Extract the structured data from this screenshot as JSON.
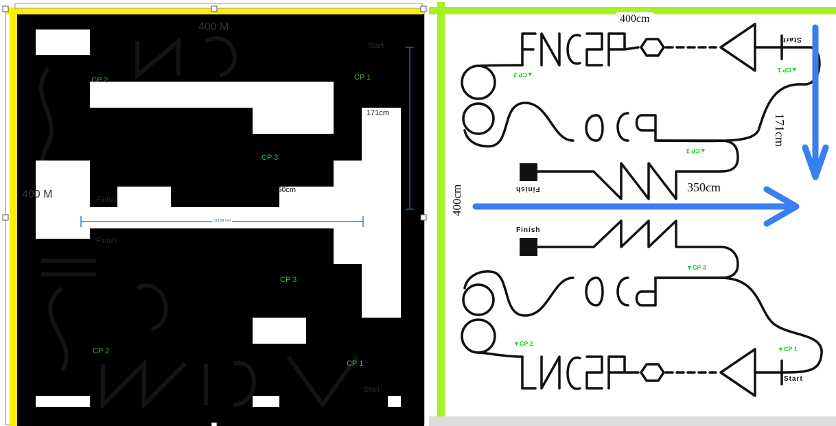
{
  "colors": {
    "yellow_border": "#ffee00",
    "green_border": "#a6f028",
    "track": "#111111",
    "arrow": "#3a7ff0",
    "checkpoint": "#17d017",
    "dimension_line": "#1f6fb0"
  },
  "left": {
    "dimensions": {
      "top_width": "400 M",
      "side_height": "400 M",
      "right_measure": "171cm",
      "middle_measure": "350cm",
      "ruler_label": "310.84 mm"
    },
    "checkpoints": {
      "cp1_top": "CP 1",
      "cp2_top": "CP 2",
      "cp3_top": "CP 3",
      "cp3_bottom": "CP 3",
      "cp2_bottom": "CP 2",
      "cp1_bottom": "CP 1"
    },
    "faint_labels": {
      "start_top": "Start",
      "finish_upper": "Finish",
      "finish_lower": "Finish",
      "start_bottom": "Start"
    }
  },
  "right": {
    "dimensions": {
      "top_width": "400cm",
      "right_height": "171cm",
      "middle_width": "350cm",
      "left_height": "400cm"
    },
    "top_track": {
      "start": "Start",
      "finish": "Finish",
      "cp1": "▲CP 1",
      "cp2": "▲CP 2",
      "cp3": "▲CP 3"
    },
    "bottom_track": {
      "start": "Start",
      "finish": "Finish",
      "cp1": "▼CP 1",
      "cp2": "▼CP 2",
      "cp3": "▼CP 3"
    }
  }
}
